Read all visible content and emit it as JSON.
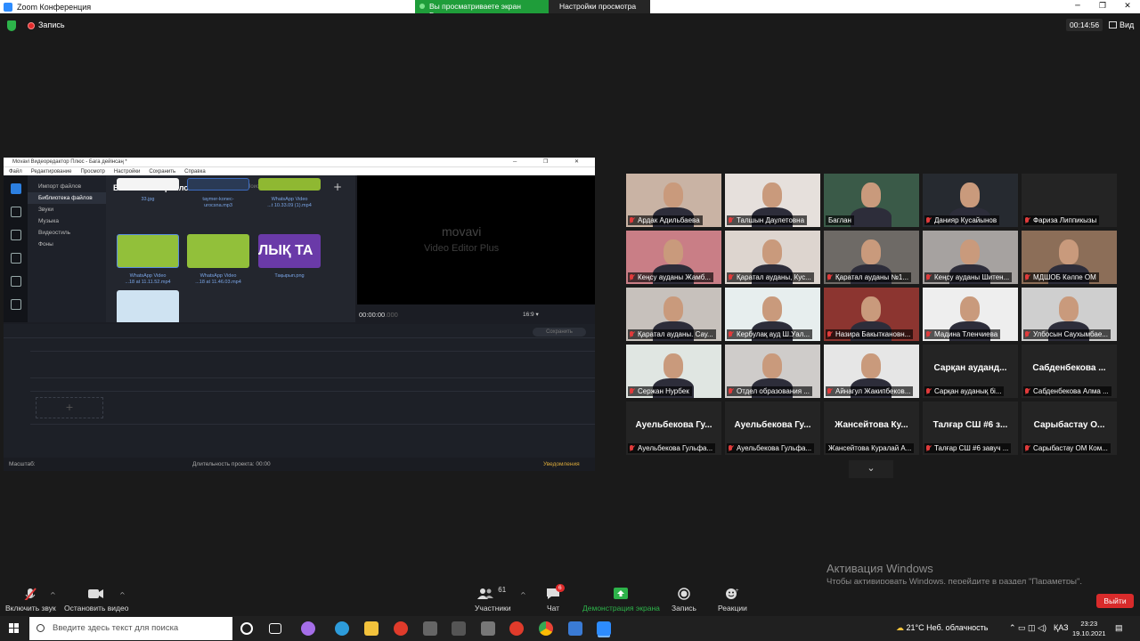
{
  "window": {
    "title": "Zoom Конференция",
    "share_banner": "Вы просматриваете экран Баглан",
    "view_options": "Настройки просмотра ⌄"
  },
  "meeting": {
    "recording_label": "Запись",
    "timer": "00:14:56",
    "view_label": "Вид"
  },
  "shared_app": {
    "title": "Movavi Видеоредактор Плюс - Бага дейінсаң *",
    "menu": [
      "Файл",
      "Редактирование",
      "Просмотр",
      "Настройки",
      "Сохранить",
      "Справка"
    ],
    "categories": [
      "Импорт файлов",
      "Библиотека файлов",
      "Звуки",
      "Музыка",
      "Видеостиль",
      "Фоны"
    ],
    "selected_category": "Библиотека файлов",
    "library_title": "Библиотека файлов",
    "search_placeholder": "Поиск",
    "files": [
      {
        "caption": "33.jpg"
      },
      {
        "caption": "taymer-konec-\nurocsna.mp3"
      },
      {
        "caption": "WhatsApp Video\n...t 10.33.09 (1).mp4"
      },
      {
        "caption": "WhatsApp Video\n...18 at 11.11.52.mp4"
      },
      {
        "caption": "WhatsApp Video\n...18 at 11.46.03.mp4"
      },
      {
        "caption": "Тақырып.png"
      }
    ],
    "thumb_text": "ЛЫҚ ТА",
    "logo": "movavi",
    "logo_sub": "Video Editor Plus",
    "preview_time": "00:00:00",
    "preview_time_ms": ".000",
    "aspect": "16:9 ▾",
    "save_label": "Сохранить",
    "scale_label": "Масштаб:",
    "duration_label": "Длительность проекта: 00:00",
    "notifications": "Уведомления"
  },
  "participants": [
    {
      "label": "Ардак Адильбаева",
      "muted": true,
      "video": true,
      "bg": "#c9b3a4"
    },
    {
      "label": "Талшын Даулетовна",
      "muted": true,
      "video": true,
      "bg": "#e6e0dc"
    },
    {
      "label": "Баглан",
      "muted": false,
      "video": true,
      "speaking": true,
      "bg": "#3a5a48"
    },
    {
      "label": "Данияр Кусайынов",
      "muted": true,
      "video": true,
      "bg": "#262a30"
    },
    {
      "label": "Фариза Липпикызы",
      "muted": true,
      "video": false
    },
    {
      "label": "Кеңсу ауданы Жамб...",
      "muted": true,
      "video": true,
      "bg": "#c97e86"
    },
    {
      "label": "Қаратал ауданы, Кус...",
      "muted": true,
      "video": true,
      "bg": "#ddd5cf"
    },
    {
      "label": "Қаратал ауданы №1...",
      "muted": true,
      "video": true,
      "bg": "#6e6a66"
    },
    {
      "label": "Кеңсу ауданы Шитен...",
      "muted": true,
      "video": true,
      "bg": "#a6a2a0"
    },
    {
      "label": "МДШОБ Кәлпе ОМ",
      "muted": true,
      "video": true,
      "bg": "#8c6e58"
    },
    {
      "label": "Қаратал ауданы. Сау...",
      "muted": true,
      "video": true,
      "bg": "#c7c1bc"
    },
    {
      "label": "Кербулақ ауд Ш.Уал...",
      "muted": true,
      "video": true,
      "bg": "#e7eeee"
    },
    {
      "label": "Назира Бакыткановн...",
      "muted": true,
      "video": true,
      "bg": "#8c3530"
    },
    {
      "label": "Мадина Тленчиева",
      "muted": true,
      "video": true,
      "bg": "#eeeeee"
    },
    {
      "label": "Улбосын Саухымбае...",
      "muted": true,
      "video": true,
      "bg": "#cfcfcf"
    },
    {
      "label": "Сержан Нурбек",
      "muted": true,
      "video": true,
      "bg": "#e0e6e2"
    },
    {
      "label": "Отдел образования ...",
      "muted": true,
      "video": true,
      "bg": "#cfccca"
    },
    {
      "label": "Айнагул Жакипбеков...",
      "muted": true,
      "video": true,
      "bg": "#e6e6e6"
    },
    {
      "name": "Сарқан ауданд...",
      "label": "Сарқан ауданық бі...",
      "muted": true,
      "video": false
    },
    {
      "name": "Сабденбекова ...",
      "label": "Сабденбекова Алма ...",
      "muted": true,
      "video": false
    },
    {
      "name": "Ауельбекова Гу...",
      "label": "Ауельбекова Гульфа...",
      "muted": true,
      "video": false
    },
    {
      "name": "Ауельбекова Гу...",
      "label": "Ауельбекова Гульфа...",
      "muted": true,
      "video": false
    },
    {
      "name": "Жансейтова Ку...",
      "label": "Жансейтова Куралай А...",
      "muted": false,
      "video": false
    },
    {
      "name": "Талғар СШ #6 з...",
      "label": "Талғар СШ #6 завуч ...",
      "muted": true,
      "video": false
    },
    {
      "name": "Сарыбастау О...",
      "label": "Сарыбастау ОМ Ком...",
      "muted": true,
      "video": false
    }
  ],
  "activation": {
    "title": "Активация Windows",
    "text": "Чтобы активировать Windows, перейдите в раздел \"Параметры\"."
  },
  "toolbar": {
    "unmute": "Включить звук",
    "stop_video": "Остановить видео",
    "participants": "Участники",
    "participants_count": "61",
    "chat": "Чат",
    "chat_badge": "6",
    "share": "Демонстрация экрана",
    "record": "Запись",
    "reactions": "Реакции",
    "leave": "Выйти",
    "share_color": "#2db34a"
  },
  "taskbar": {
    "search_placeholder": "Введите здесь текст для поиска",
    "weather": "21°C  Неб. облачность",
    "lang": "ҚАЗ",
    "time": "23:23",
    "date": "19.10.2021"
  }
}
